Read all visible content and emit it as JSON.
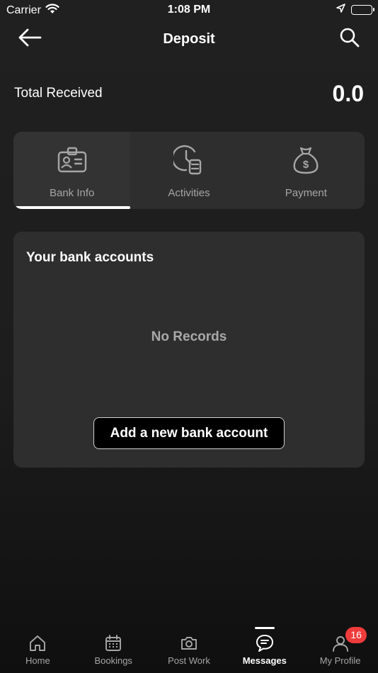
{
  "status_bar": {
    "carrier": "Carrier",
    "time": "1:08 PM"
  },
  "header": {
    "title": "Deposit",
    "back_icon": "arrow-left-icon",
    "search_icon": "search-icon"
  },
  "summary": {
    "label": "Total Received",
    "value": "0.0"
  },
  "tabs": [
    {
      "label": "Bank Info",
      "icon": "id-card-icon",
      "active": true
    },
    {
      "label": "Activities",
      "icon": "clock-coins-icon",
      "active": false
    },
    {
      "label": "Payment",
      "icon": "money-bag-icon",
      "active": false
    }
  ],
  "bank_accounts": {
    "title": "Your bank accounts",
    "empty_text": "No Records",
    "add_button_label": "Add a new bank account"
  },
  "tab_bar": {
    "items": [
      {
        "label": "Home",
        "icon": "home-icon"
      },
      {
        "label": "Bookings",
        "icon": "calendar-icon"
      },
      {
        "label": "Post Work",
        "icon": "camera-icon"
      },
      {
        "label": "Messages",
        "icon": "chat-icon",
        "active": true
      },
      {
        "label": "My Profile",
        "icon": "user-icon",
        "badge": "16"
      }
    ]
  },
  "colors": {
    "background": "#1f1f1f",
    "card": "#2e2e2e",
    "text_secondary": "#a6a6a6",
    "badge": "#ef3b3b"
  }
}
